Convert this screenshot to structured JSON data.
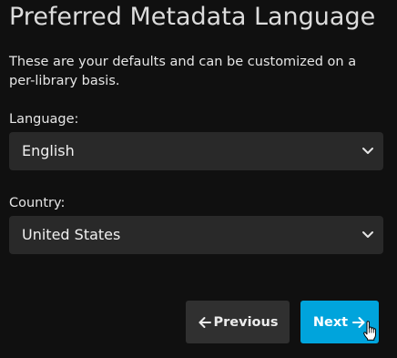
{
  "page": {
    "title": "Preferred Metadata Language",
    "description": "These are your defaults and can be customized on a per-library basis."
  },
  "language": {
    "label": "Language:",
    "selected": "English"
  },
  "country": {
    "label": "Country:",
    "selected": "United States"
  },
  "buttons": {
    "previous_label": "Previous",
    "next_label": "Next"
  },
  "icons": {
    "language_chevron": "chevron-down-icon",
    "country_chevron": "chevron-down-icon",
    "previous": "arrow-left-icon",
    "next": "arrow-right-icon",
    "cursor": "hand-pointer-cursor"
  },
  "colors": {
    "background": "#101010",
    "select_background": "#292929",
    "previous_button": "#303030",
    "accent": "#00a4dc"
  }
}
